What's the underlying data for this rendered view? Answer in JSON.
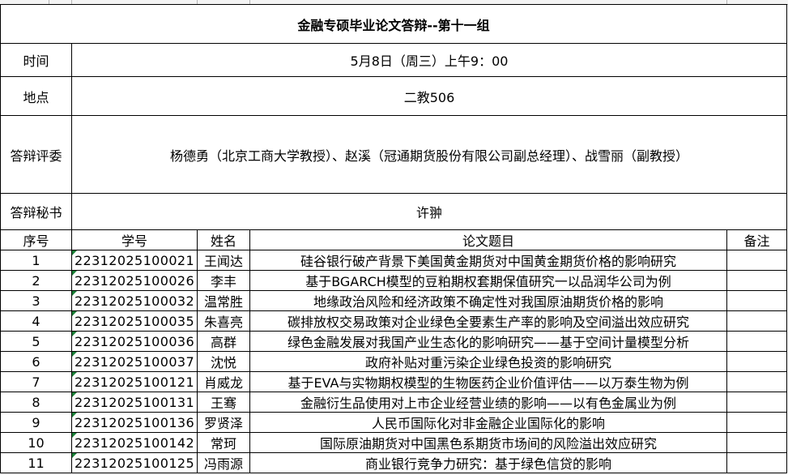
{
  "sheet": {
    "title": "金融专硕毕业论文答辩--第十一组",
    "info": [
      {
        "label": "时间",
        "value": "5月8日（周三）上午9：00"
      },
      {
        "label": "地点",
        "value": "二教506"
      },
      {
        "label": "答辩评委",
        "value": "杨德勇（北京工商大学教授）、赵溪（冠通期货股份有限公司副总经理）、战雪丽（副教授）"
      },
      {
        "label": "答辩秘书",
        "value": "许翀"
      }
    ],
    "columns": [
      "序号",
      "学号",
      "姓名",
      "论文题目",
      "备注"
    ],
    "rows": [
      {
        "no": "1",
        "id": "22312025100021",
        "name": "王闻达",
        "topic": "硅谷银行破产背景下美国黄金期货对中国黄金期货价格的影响研究",
        "note": ""
      },
      {
        "no": "2",
        "id": "22312025100026",
        "name": "李丰",
        "topic": "基于BGARCH模型的豆粕期权套期保值研究一以品润华公司为例",
        "note": ""
      },
      {
        "no": "3",
        "id": "22312025100032",
        "name": "温常胜",
        "topic": "地缘政治风险和经济政策不确定性对我国原油期货价格的影响",
        "note": ""
      },
      {
        "no": "4",
        "id": "22312025100035",
        "name": "朱喜亮",
        "topic": "碳排放权交易政策对企业绿色全要素生产率的影响及空间溢出效应研究",
        "note": ""
      },
      {
        "no": "5",
        "id": "22312025100036",
        "name": "高群",
        "topic": "绿色金融发展对我国产业生态化的影响研究——基于空间计量模型分析",
        "note": ""
      },
      {
        "no": "6",
        "id": "22312025100037",
        "name": "沈悦",
        "topic": "政府补贴对重污染企业绿色投资的影响研究",
        "note": ""
      },
      {
        "no": "7",
        "id": "22312025100121",
        "name": "肖威龙",
        "topic": "基于EVA与实物期权模型的生物医药企业价值评估——以万泰生物为例",
        "note": ""
      },
      {
        "no": "8",
        "id": "22312025100131",
        "name": "王骞",
        "topic": "金融衍生品使用对上市企业经营业绩的影响——以有色金属业为例",
        "note": ""
      },
      {
        "no": "9",
        "id": "22312025100136",
        "name": "罗贤泽",
        "topic": "人民币国际化对非金融企业国际化的影响",
        "note": ""
      },
      {
        "no": "10",
        "id": "22312025100142",
        "name": "常珂",
        "topic": "国际原油期货对中国黑色系期货市场间的风险溢出效应研究",
        "note": ""
      },
      {
        "no": "11",
        "id": "22312025100125",
        "name": "冯雨源",
        "topic": "商业银行竞争力研究：基于绿色信贷的影响",
        "note": ""
      }
    ]
  },
  "colors": {
    "grid": "#000000",
    "selection": "#1a7f37",
    "error_triangle": "#1a7f37"
  }
}
